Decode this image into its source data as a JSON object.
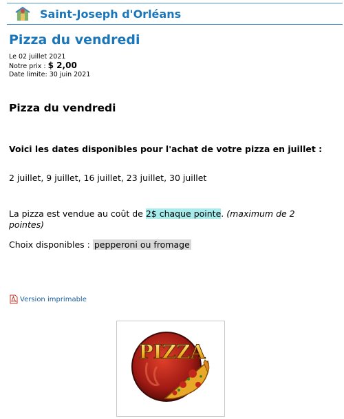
{
  "header": {
    "site_title": "Saint-Joseph d'Orléans",
    "logo_icon": "school-logo-icon"
  },
  "page": {
    "title": "Pizza du vendredi",
    "date_line": "Le 02 juillet 2021",
    "price_label": "Notre prix : ",
    "price_value": "$ 2,00",
    "deadline": "Date limite: 30 juin 2021"
  },
  "content": {
    "heading": "Pizza du vendredi",
    "subheading": "Voici les dates disponibles pour l'achat de votre pizza en juillet :",
    "dates": "2 juillet, 9 juillet, 16 juillet, 23 juillet, 30 juillet",
    "price_prefix": "La pizza est vendue au coût de ",
    "price_highlight": "2$ chaque pointe",
    "price_period": ". ",
    "price_note": "(maximum de 2 pointes)",
    "choices_label": "Choix disponibles : ",
    "choices_value": "pepperoni ou fromage"
  },
  "links": {
    "printable": "Version imprimable",
    "printable_icon": "pdf-icon"
  },
  "image": {
    "logo_text": "PIZZA",
    "name": "pizza-image"
  },
  "colors": {
    "accent": "#1a76b8",
    "highlight_cyan": "#a6ecec",
    "highlight_grey": "#d8d8d8"
  }
}
